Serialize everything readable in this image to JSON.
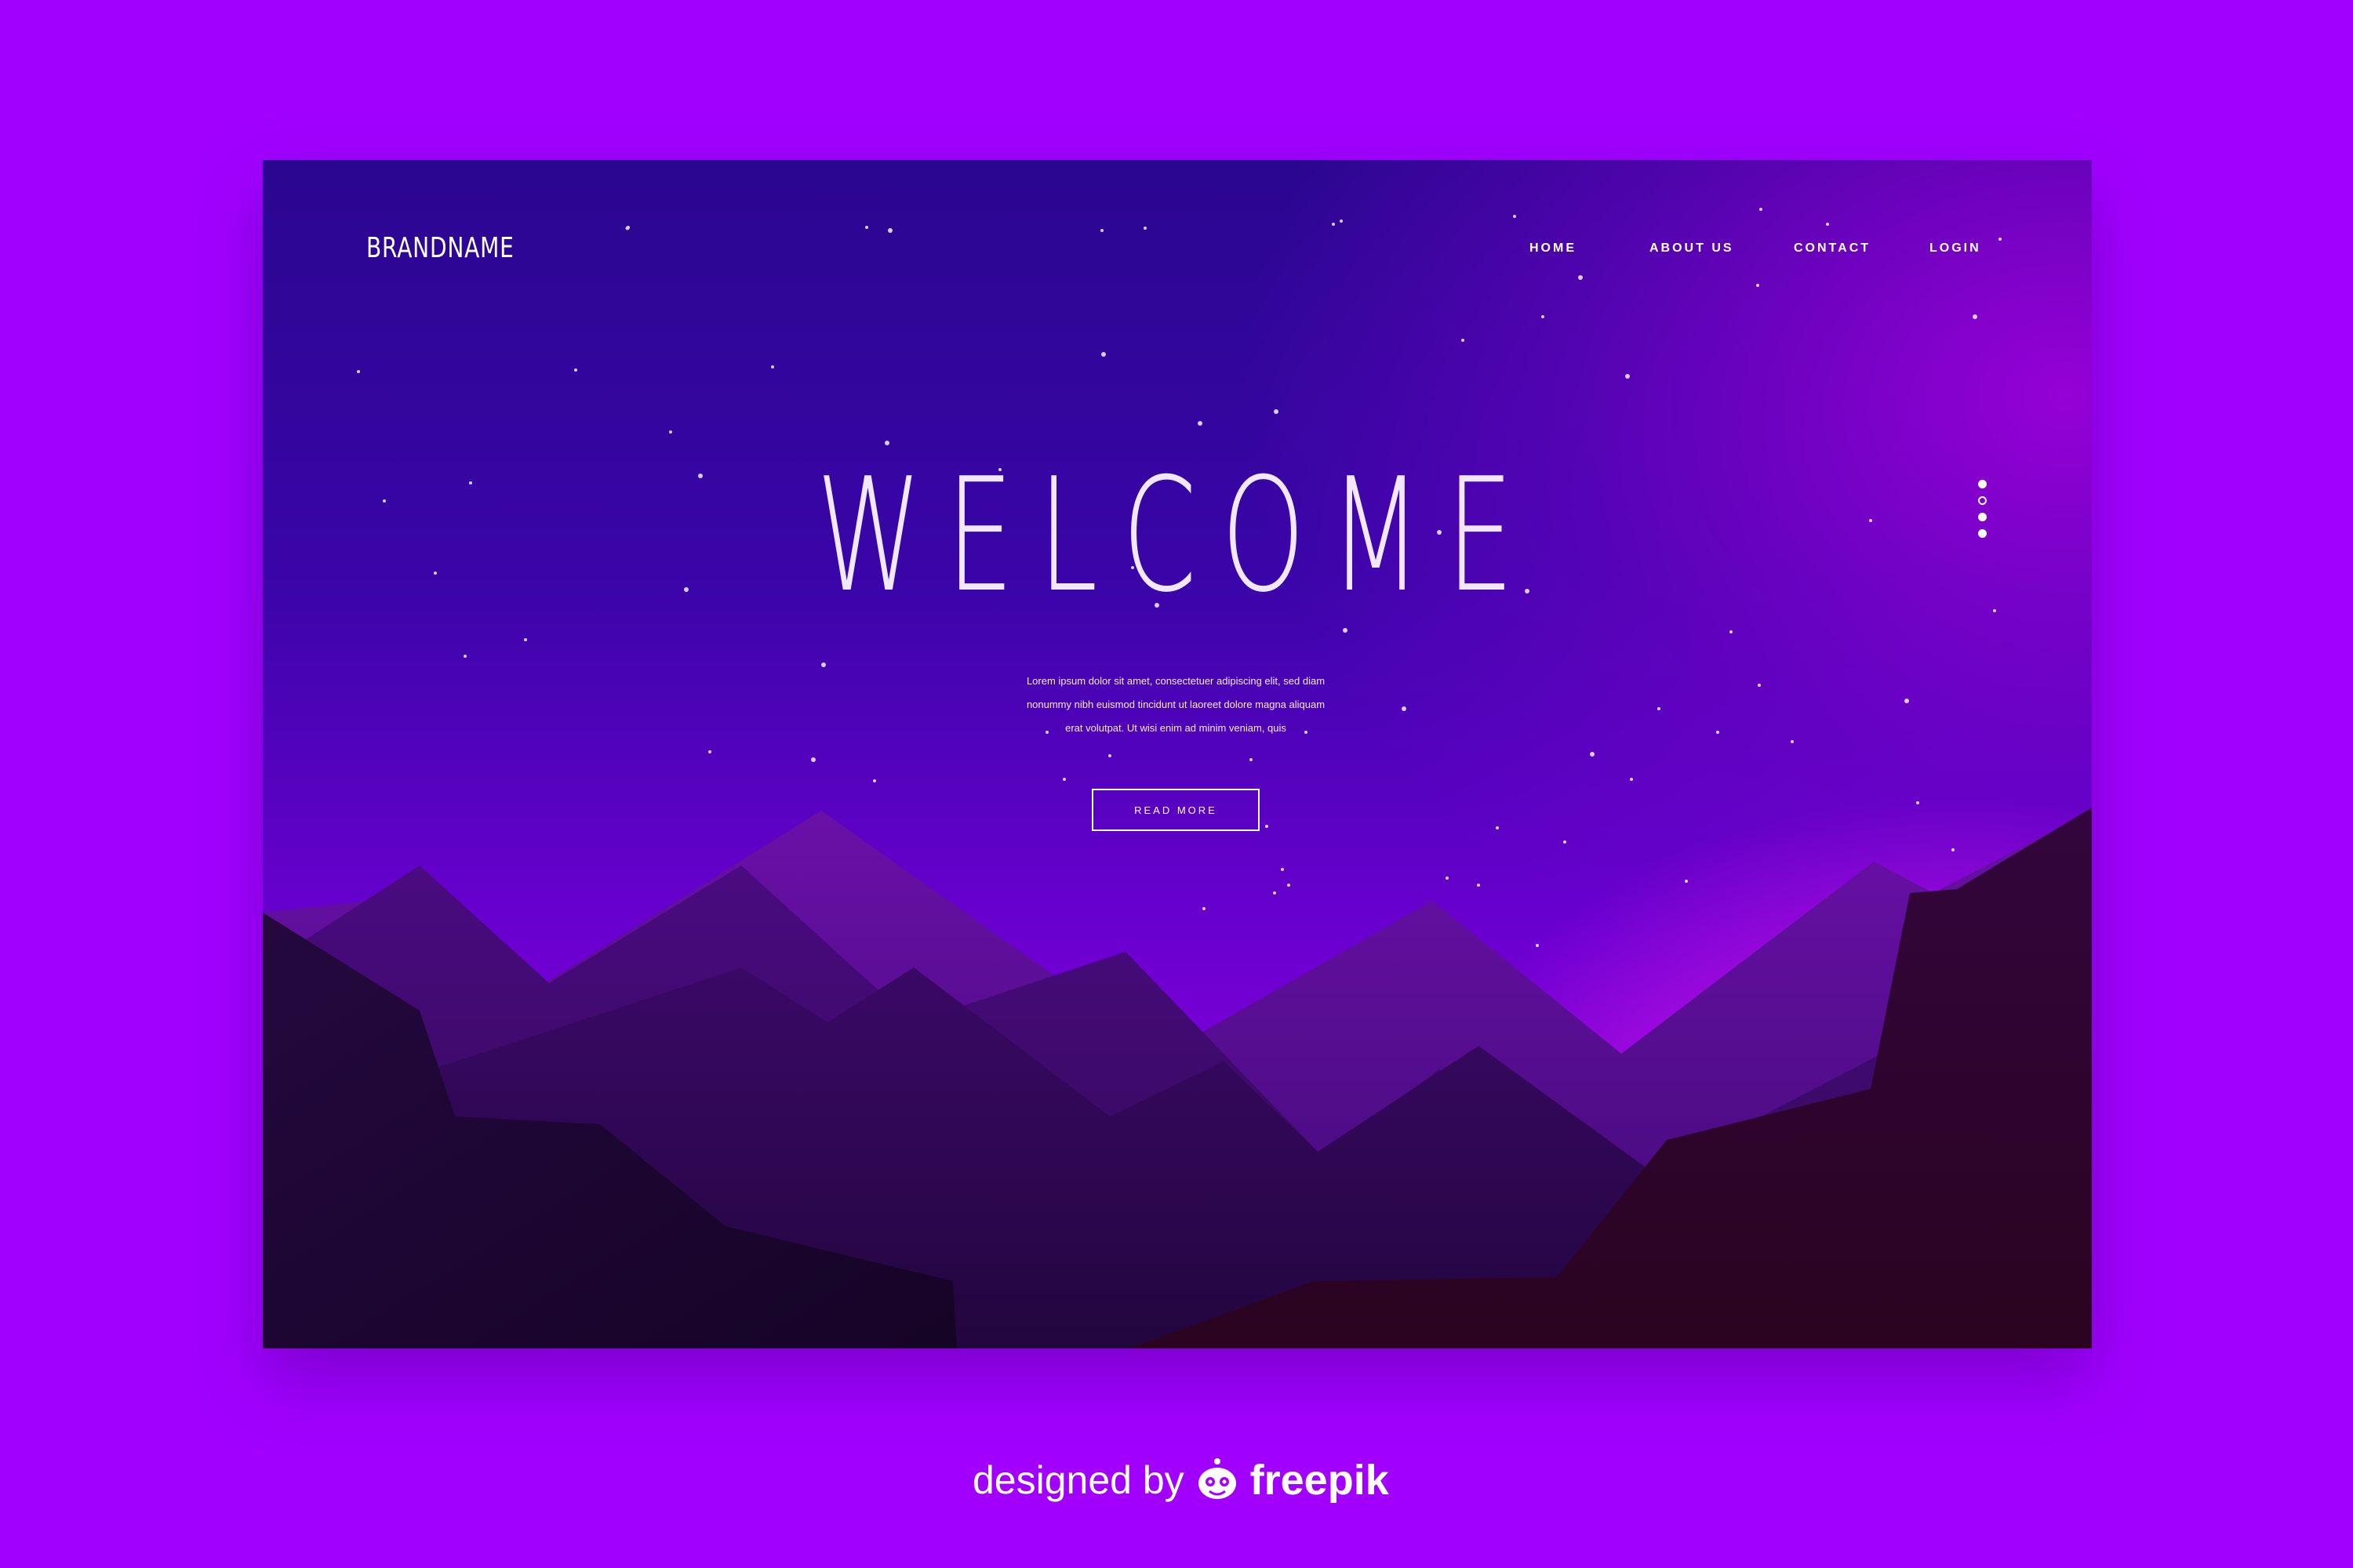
{
  "colors": {
    "page_background": "#a100ff",
    "text": "#ffffff",
    "pink_glow": "#ff2ef0"
  },
  "header": {
    "brand": "BRANDNAME",
    "nav": [
      {
        "label": "HOME"
      },
      {
        "label": "ABOUT US"
      },
      {
        "label": "CONTACT"
      },
      {
        "label": "LOGIN"
      }
    ]
  },
  "hero": {
    "title": "WELCOME",
    "text_lines": [
      "Lorem ipsum dolor sit amet, consectetuer adipiscing elit, sed diam",
      "nonummy nibh euismod tincidunt ut laoreet dolore magna aliquam",
      "erat volutpat. Ut wisi enim ad minim veniam, quis"
    ],
    "button": "READ MORE"
  },
  "slider": {
    "count": 4,
    "active_index": 1
  },
  "credit": {
    "prefix": "designed by",
    "brand": "freepik",
    "logo_icon": "freepik-logo-icon"
  }
}
